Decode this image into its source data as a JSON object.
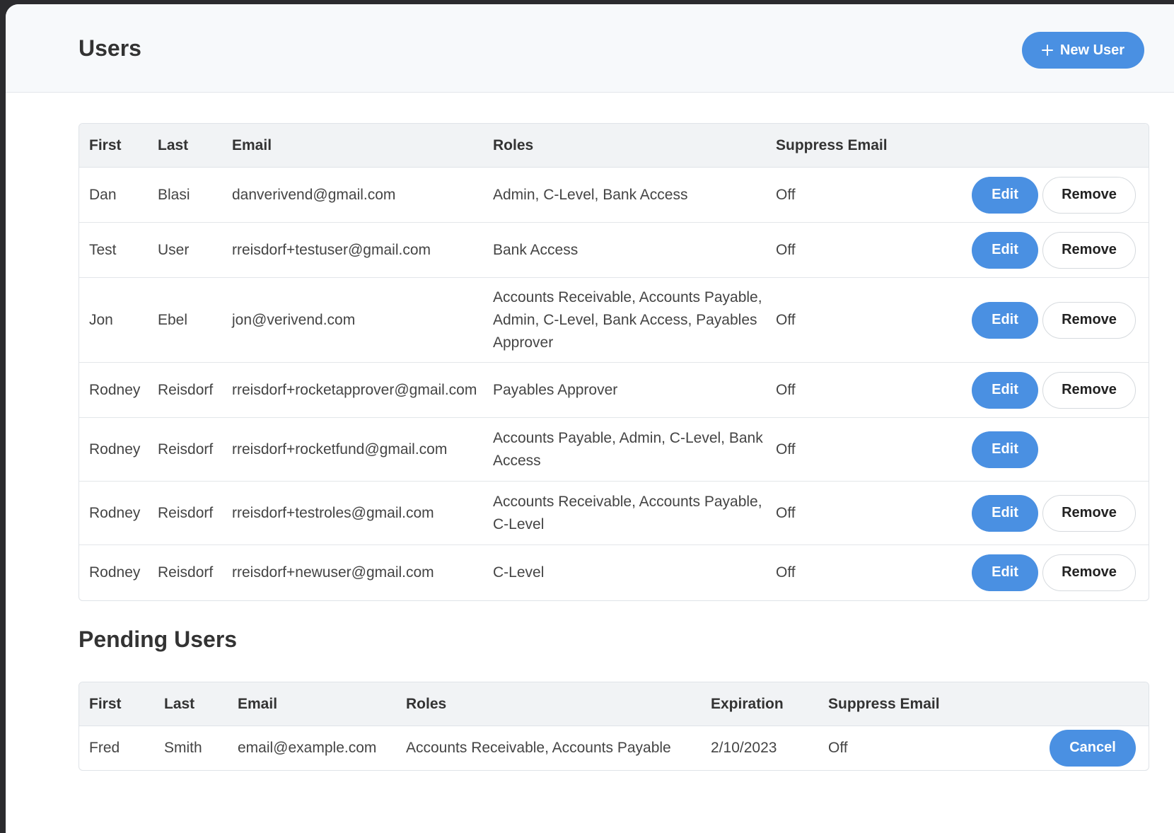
{
  "header": {
    "title": "Users",
    "new_user_label": "New User"
  },
  "users_table": {
    "columns": [
      "First",
      "Last",
      "Email",
      "Roles",
      "Suppress Email"
    ],
    "rows": [
      {
        "first": "Dan",
        "last": "Blasi",
        "email": "danverivend@gmail.com",
        "roles": "Admin, C-Level, Bank Access",
        "suppress_email": "Off",
        "edit_label": "Edit",
        "remove_label": "Remove"
      },
      {
        "first": "Test",
        "last": "User",
        "email": "rreisdorf+testuser@gmail.com",
        "roles": "Bank Access",
        "suppress_email": "Off",
        "edit_label": "Edit",
        "remove_label": "Remove"
      },
      {
        "first": "Jon",
        "last": "Ebel",
        "email": "jon@verivend.com",
        "roles": "Accounts Receivable, Accounts Payable, Admin, C-Level, Bank Access, Payables Approver",
        "suppress_email": "Off",
        "edit_label": "Edit",
        "remove_label": "Remove"
      },
      {
        "first": "Rodney",
        "last": "Reisdorf",
        "email": "rreisdorf+rocketapprover@gmail.com",
        "roles": "Payables Approver",
        "suppress_email": "Off",
        "edit_label": "Edit",
        "remove_label": "Remove"
      },
      {
        "first": "Rodney",
        "last": "Reisdorf",
        "email": "rreisdorf+rocketfund@gmail.com",
        "roles": "Accounts Payable, Admin, C-Level, Bank Access",
        "suppress_email": "Off",
        "edit_label": "Edit",
        "remove_label": null
      },
      {
        "first": "Rodney",
        "last": "Reisdorf",
        "email": "rreisdorf+testroles@gmail.com",
        "roles": "Accounts Receivable, Accounts Payable, C-Level",
        "suppress_email": "Off",
        "edit_label": "Edit",
        "remove_label": "Remove"
      },
      {
        "first": "Rodney",
        "last": "Reisdorf",
        "email": "rreisdorf+newuser@gmail.com",
        "roles": "C-Level",
        "suppress_email": "Off",
        "edit_label": "Edit",
        "remove_label": "Remove"
      }
    ]
  },
  "pending_section": {
    "title": "Pending Users"
  },
  "pending_table": {
    "columns": [
      "First",
      "Last",
      "Email",
      "Roles",
      "Expiration",
      "Suppress Email"
    ],
    "rows": [
      {
        "first": "Fred",
        "last": "Smith",
        "email": "email@example.com",
        "roles": "Accounts Receivable, Accounts Payable",
        "expiration": "2/10/2023",
        "suppress_email": "Off",
        "cancel_label": "Cancel"
      }
    ]
  },
  "colors": {
    "accent": "#4a90e2",
    "header_bg": "#f7f9fb",
    "table_header_bg": "#f1f3f5"
  },
  "icons": {
    "new_user": "plus-icon"
  }
}
